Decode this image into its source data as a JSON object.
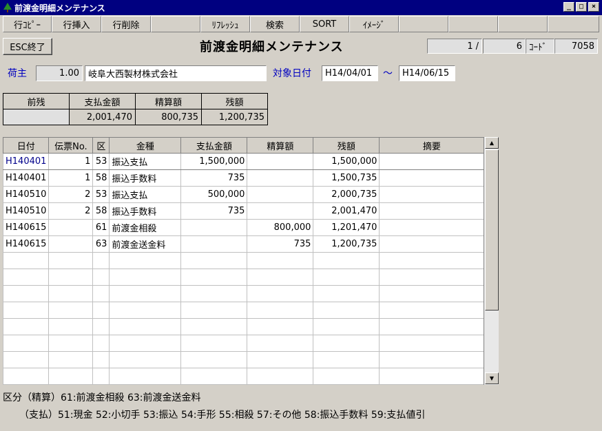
{
  "window": {
    "title": "前渡金明細メンテナンス",
    "min": "_",
    "max": "□",
    "close": "×"
  },
  "toolbar": [
    "行ｺﾋﾟｰ",
    "行挿入",
    "行削除",
    "",
    "ﾘﾌﾚｯｼｭ",
    "検索",
    "SORT",
    "ｲﾒｰｼﾞ",
    "",
    "",
    "",
    ""
  ],
  "esc_label": "ESC終了",
  "page_title": "前渡金明細メンテナンス",
  "record": {
    "current": "1",
    "sep": "/",
    "total": "6",
    "code_label": "ｺｰﾄﾞ",
    "code": "7058"
  },
  "shipper": {
    "label": "荷主",
    "code": "1.00",
    "name": "岐阜大西製材株式会社"
  },
  "date_range": {
    "label": "対象日付",
    "from": "H14/04/01",
    "tilde": "～",
    "to": "H14/06/15"
  },
  "summary": {
    "headers": [
      "前残",
      "支払金額",
      "精算額",
      "残額"
    ],
    "values": [
      "",
      "2,001,470",
      "800,735",
      "1,200,735"
    ]
  },
  "grid": {
    "headers": [
      "日付",
      "伝票No.",
      "区",
      "金種",
      "支払金額",
      "精算額",
      "残額",
      "摘要"
    ],
    "rows": [
      [
        "H140401",
        "1",
        "53",
        "振込支払",
        "1,500,000",
        "",
        "1,500,000",
        ""
      ],
      [
        "H140401",
        "1",
        "58",
        "振込手数料",
        "735",
        "",
        "1,500,735",
        ""
      ],
      [
        "H140510",
        "2",
        "53",
        "振込支払",
        "500,000",
        "",
        "2,000,735",
        ""
      ],
      [
        "H140510",
        "2",
        "58",
        "振込手数料",
        "735",
        "",
        "2,001,470",
        ""
      ],
      [
        "H140615",
        "",
        "61",
        "前渡金相殺",
        "",
        "800,000",
        "1,201,470",
        ""
      ],
      [
        "H140615",
        "",
        "63",
        "前渡金送金料",
        "",
        "735",
        "1,200,735",
        ""
      ]
    ],
    "empty_rows": 8
  },
  "footer": {
    "line1": "区分（精算）61:前渡金相殺 63:前渡金送金料",
    "line2": "（支払）51:現金 52:小切手 53:振込 54:手形 55:相殺 57:その他 58:振込手数料 59:支払値引"
  },
  "scroll": {
    "up": "▲",
    "down": "▼"
  }
}
